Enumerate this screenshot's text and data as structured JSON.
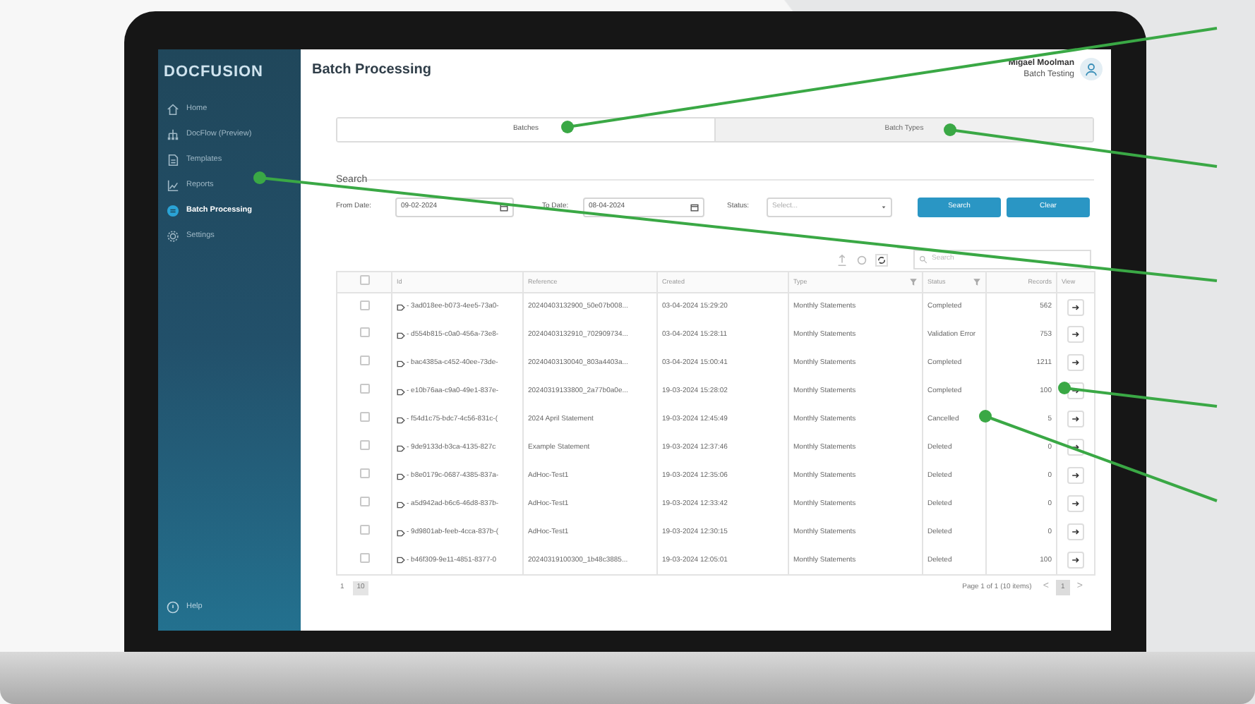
{
  "sidebar": {
    "logo": "DOCFUSION",
    "items": [
      {
        "label": "Home",
        "selected": false
      },
      {
        "label": "DocFlow (Preview)",
        "selected": false
      },
      {
        "label": "Templates",
        "selected": false
      },
      {
        "label": "Reports",
        "selected": false
      },
      {
        "label": "Batch Processing",
        "selected": true
      },
      {
        "label": "Settings",
        "selected": false
      }
    ],
    "help": "Help"
  },
  "header": {
    "title": "Batch Processing",
    "user_name": "Migael Moolman",
    "user_role": "Batch Testing"
  },
  "tabs": [
    {
      "label": "Batches",
      "selected": true
    },
    {
      "label": "Batch Types",
      "selected": false
    }
  ],
  "search": {
    "title": "Search",
    "from_label": "From Date:",
    "from_value": "09-02-2024",
    "to_label": "To Date:",
    "to_value": "08-04-2024",
    "status_label": "Status:",
    "status_placeholder": "Select...",
    "buttons": [
      "Search",
      "Clear"
    ]
  },
  "grid_search": {
    "placeholder": "Search"
  },
  "table": {
    "select_all_checked": false,
    "columns": [
      {
        "label": "Id",
        "filter": false
      },
      {
        "label": "Reference",
        "filter": false
      },
      {
        "label": "Created",
        "filter": false
      },
      {
        "label": "Type",
        "filter": true
      },
      {
        "label": "Status",
        "filter": true
      },
      {
        "label": "Records",
        "filter": false
      },
      {
        "label": "View",
        "filter": false
      }
    ],
    "rows": [
      {
        "checked": false,
        "cells": [
          "- 3ad018ee-b073-4ee5-73a0-",
          "20240403132900_50e07b008...",
          "03-04-2024 15:29:20",
          "Monthly Statements",
          "Completed",
          "562"
        ]
      },
      {
        "checked": false,
        "cells": [
          "- d554b815-c0a0-456a-73e8-",
          "20240403132910_702909734...",
          "03-04-2024 15:28:11",
          "Monthly Statements",
          "Validation Error",
          "753"
        ]
      },
      {
        "checked": false,
        "cells": [
          "- bac4385a-c452-40ee-73de-",
          "20240403130040_803a4403a...",
          "03-04-2024 15:00:41",
          "Monthly Statements",
          "Completed",
          "1211"
        ]
      },
      {
        "checked": false,
        "cells": [
          "- e10b76aa-c9a0-49e1-837e-",
          "20240319133800_2a77b0a0e...",
          "19-03-2024 15:28:02",
          "Monthly Statements",
          "Completed",
          "100"
        ]
      },
      {
        "checked": false,
        "cells": [
          "- f54d1c75-bdc7-4c56-831c-(",
          "2024 April Statement",
          "19-03-2024 12:45:49",
          "Monthly Statements",
          "Cancelled",
          "5"
        ]
      },
      {
        "checked": false,
        "cells": [
          "- 9de9133d-b3ca-4135-827c",
          "Example Statement",
          "19-03-2024 12:37:46",
          "Monthly Statements",
          "Deleted",
          "0"
        ]
      },
      {
        "checked": false,
        "cells": [
          "- b8e0179c-0687-4385-837a-",
          "AdHoc-Test1",
          "19-03-2024 12:35:06",
          "Monthly Statements",
          "Deleted",
          "0"
        ]
      },
      {
        "checked": false,
        "cells": [
          "- a5d942ad-b6c6-46d8-837b-",
          "AdHoc-Test1",
          "19-03-2024 12:33:42",
          "Monthly Statements",
          "Deleted",
          "0"
        ]
      },
      {
        "checked": false,
        "cells": [
          "- 9d9801ab-feeb-4cca-837b-(",
          "AdHoc-Test1",
          "19-03-2024 12:30:15",
          "Monthly Statements",
          "Deleted",
          "0"
        ]
      },
      {
        "checked": false,
        "cells": [
          "- b46f309-9e11-4851-8377-0",
          "20240319100300_1b48c3885...",
          "19-03-2024 12:05:01",
          "Monthly Statements",
          "Deleted",
          "100"
        ]
      }
    ]
  },
  "pager": {
    "first_page": "1",
    "page_size": "10",
    "summary": "Page 1 of 1 (10 items)",
    "prev": "<",
    "page": "1",
    "next": ">"
  }
}
